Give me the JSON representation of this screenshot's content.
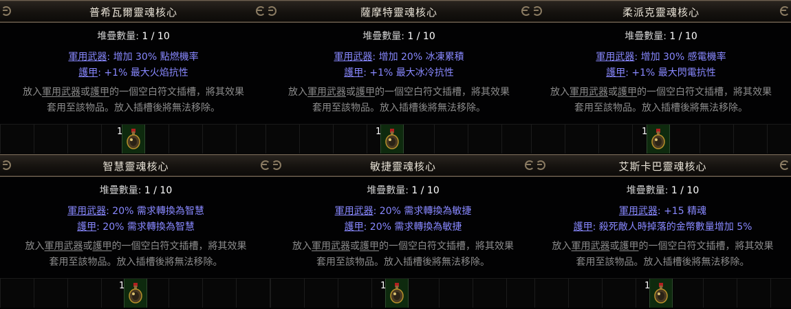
{
  "cards": [
    {
      "title": "普希瓦爾靈魂核心",
      "stack_label": "堆疊數量: ",
      "stack_value": "1 / 10",
      "weapon_prefix": "軍用武器",
      "weapon_text": ": 增加 30% 點燃機率",
      "armour_prefix": "護甲",
      "armour_text": ": +1% 最大火焰抗性",
      "desc_kw1": "軍用武器",
      "desc_kw2": "護甲",
      "desc_line1_a": "放入",
      "desc_line1_b": "或",
      "desc_line1_c": "的一個空白符文插槽，將其效果",
      "desc_line2": "套用至該物品。放入插槽後將無法移除。",
      "item_quantity": "1",
      "icon": "soul-core-flask-icon"
    },
    {
      "title": "薩摩特靈魂核心",
      "stack_label": "堆疊數量: ",
      "stack_value": "1 / 10",
      "weapon_prefix": "軍用武器",
      "weapon_text": ": 增加 20% 冰凍累積",
      "armour_prefix": "護甲",
      "armour_text": ": +1% 最大冰冷抗性",
      "desc_kw1": "軍用武器",
      "desc_kw2": "護甲",
      "desc_line1_a": "放入",
      "desc_line1_b": "或",
      "desc_line1_c": "的一個空白符文插槽，將其效果",
      "desc_line2": "套用至該物品。放入插槽後將無法移除。",
      "item_quantity": "1",
      "icon": "soul-core-flask-icon"
    },
    {
      "title": "柔派克靈魂核心",
      "stack_label": "堆疊數量: ",
      "stack_value": "1 / 10",
      "weapon_prefix": "軍用武器",
      "weapon_text": ": 增加 30% 感電機率",
      "armour_prefix": "護甲",
      "armour_text": ": +1% 最大閃電抗性",
      "desc_kw1": "軍用武器",
      "desc_kw2": "護甲",
      "desc_line1_a": "放入",
      "desc_line1_b": "或",
      "desc_line1_c": "的一個空白符文插槽，將其效果",
      "desc_line2": "套用至該物品。放入插槽後將無法移除。",
      "item_quantity": "1",
      "icon": "soul-core-flask-icon"
    },
    {
      "title": "智慧靈魂核心",
      "stack_label": "堆疊數量: ",
      "stack_value": "1 / 10",
      "weapon_prefix": "軍用武器",
      "weapon_text": ": 20% 需求轉換為智慧",
      "armour_prefix": "護甲",
      "armour_text": ": 20% 需求轉換為智慧",
      "desc_kw1": "軍用武器",
      "desc_kw2": "護甲",
      "desc_line1_a": "放入",
      "desc_line1_b": "或",
      "desc_line1_c": "的一個空白符文插槽，將其效果",
      "desc_line2": "套用至該物品。放入插槽後將無法移除。",
      "item_quantity": "1",
      "icon": "soul-core-flask-icon"
    },
    {
      "title": "敏捷靈魂核心",
      "stack_label": "堆疊數量: ",
      "stack_value": "1 / 10",
      "weapon_prefix": "軍用武器",
      "weapon_text": ": 20% 需求轉換為敏捷",
      "armour_prefix": "護甲",
      "armour_text": ": 20% 需求轉換為敏捷",
      "desc_kw1": "軍用武器",
      "desc_kw2": "護甲",
      "desc_line1_a": "放入",
      "desc_line1_b": "或",
      "desc_line1_c": "的一個空白符文插槽，將其效果",
      "desc_line2": "套用至該物品。放入插槽後將無法移除。",
      "item_quantity": "1",
      "icon": "soul-core-flask-icon"
    },
    {
      "title": "艾斯卡巴靈魂核心",
      "stack_label": "堆疊數量: ",
      "stack_value": "1 / 10",
      "weapon_prefix": "軍用武器",
      "weapon_text": ": +15 精魂",
      "armour_prefix": "護甲",
      "armour_text": ": 殺死敵人時掉落的金幣數量增加 5%",
      "desc_kw1": "軍用武器",
      "desc_kw2": "護甲",
      "desc_line1_a": "放入",
      "desc_line1_b": "或",
      "desc_line1_c": "的一個空白符文插槽，將其效果",
      "desc_line2": "套用至該物品。放入插槽後將無法移除。",
      "item_quantity": "1",
      "icon": "soul-core-flask-icon"
    }
  ],
  "colors": {
    "title": "#e8e2d6",
    "modifier": "#8888ff",
    "description": "#8c8c8c",
    "slot_highlight": "#0e2a0e"
  }
}
